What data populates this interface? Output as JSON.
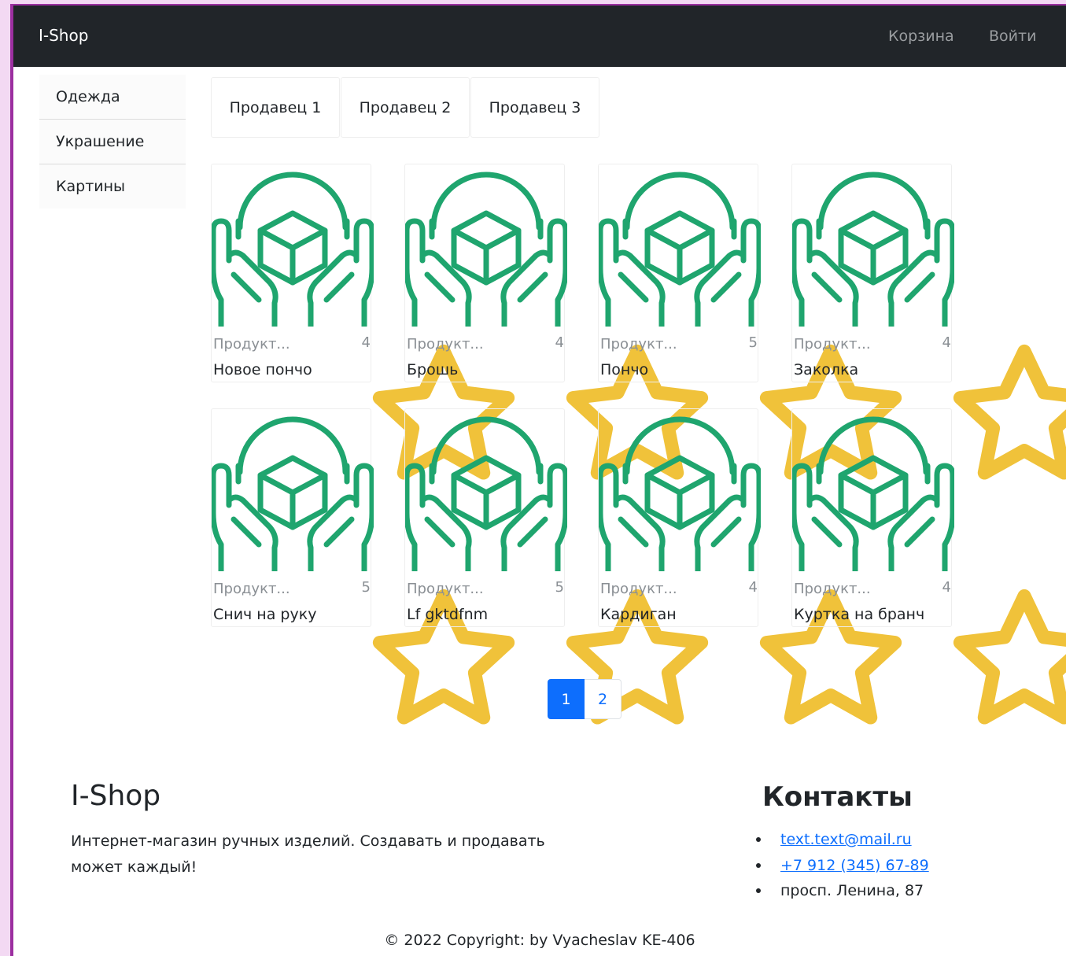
{
  "navbar": {
    "brand": "I-Shop",
    "links": {
      "cart": "Корзина",
      "login": "Войти"
    }
  },
  "sidebar": {
    "items": [
      {
        "label": "Одежда"
      },
      {
        "label": "Украшение"
      },
      {
        "label": "Картины"
      }
    ]
  },
  "sellers": [
    {
      "label": "Продавец 1"
    },
    {
      "label": "Продавец 2"
    },
    {
      "label": "Продавец 3"
    }
  ],
  "products": [
    {
      "subtitle": "Продукт...",
      "rating": "4",
      "title": "Новое пончо"
    },
    {
      "subtitle": "Продукт...",
      "rating": "4",
      "title": "Брошь"
    },
    {
      "subtitle": "Продукт...",
      "rating": "5",
      "title": "Пончо"
    },
    {
      "subtitle": "Продукт...",
      "rating": "4",
      "title": "Заколка"
    },
    {
      "subtitle": "Продукт...",
      "rating": "5",
      "title": "Снич на руку"
    },
    {
      "subtitle": "Продукт...",
      "rating": "5",
      "title": "Lf gktdfnm"
    },
    {
      "subtitle": "Продукт...",
      "rating": "4",
      "title": "Кардиган"
    },
    {
      "subtitle": "Продукт...",
      "rating": "4",
      "title": "Куртка на бранч"
    }
  ],
  "pagination": {
    "pages": [
      "1",
      "2"
    ],
    "current": "1"
  },
  "footer": {
    "title": "I-Shop",
    "description": "Интернет-магазин ручных изделий. Создавать и продавать может каждый!",
    "contacts_title": "Контакты",
    "email": "text.text@mail.ru",
    "phone": "+7 912 (345) 67-89",
    "address": "просп. Ленина, 87",
    "copyright": "© 2022 Copyright: by Vyacheslav KE-406"
  },
  "colors": {
    "navbar_bg": "#212529",
    "icon_green": "#1fa56e",
    "star_yellow": "#f0c23a",
    "accent_blue": "#0d6efd"
  },
  "icons": {
    "product": "hands-holding-box-icon",
    "rating": "star-icon"
  }
}
